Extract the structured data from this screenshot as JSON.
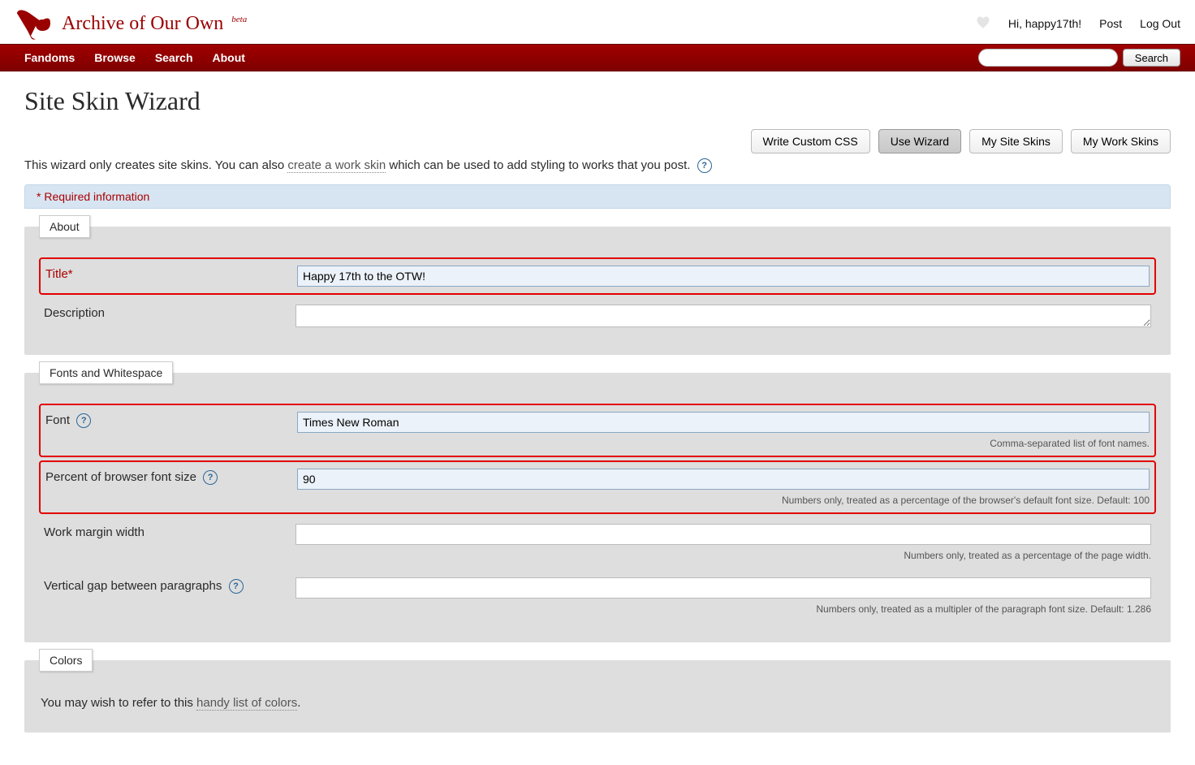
{
  "site": {
    "title": "Archive of Our Own",
    "beta": "beta"
  },
  "user_nav": {
    "greeting": "Hi, happy17th!",
    "post": "Post",
    "logout": "Log Out"
  },
  "main_nav": {
    "fandoms": "Fandoms",
    "browse": "Browse",
    "search": "Search",
    "about": "About",
    "search_button": "Search"
  },
  "page": {
    "title": "Site Skin Wizard",
    "intro_prefix": "This wizard only creates site skins. You can also ",
    "intro_link": "create a work skin",
    "intro_suffix": " which can be used to add styling to works that you post.",
    "required": "* Required information"
  },
  "actions": {
    "write_css": "Write Custom CSS",
    "use_wizard": "Use Wizard",
    "my_site": "My Site Skins",
    "my_work": "My Work Skins"
  },
  "sections": {
    "about": {
      "legend": "About",
      "title_label": "Title*",
      "title_value": "Happy 17th to the OTW!",
      "description_label": "Description",
      "description_value": ""
    },
    "fonts": {
      "legend": "Fonts and Whitespace",
      "font_label": "Font",
      "font_value": "Times New Roman",
      "font_hint": "Comma-separated list of font names.",
      "percent_label": "Percent of browser font size",
      "percent_value": "90",
      "percent_hint": "Numbers only, treated as a percentage of the browser's default font size. Default: 100",
      "margin_label": "Work margin width",
      "margin_value": "",
      "margin_hint": "Numbers only, treated as a percentage of the page width.",
      "gap_label": "Vertical gap between paragraphs",
      "gap_value": "",
      "gap_hint": "Numbers only, treated as a multipler of the paragraph font size. Default: 1.286"
    },
    "colors": {
      "legend": "Colors",
      "intro_prefix": "You may wish to refer to this ",
      "intro_link": "handy list of colors",
      "intro_suffix": "."
    }
  }
}
